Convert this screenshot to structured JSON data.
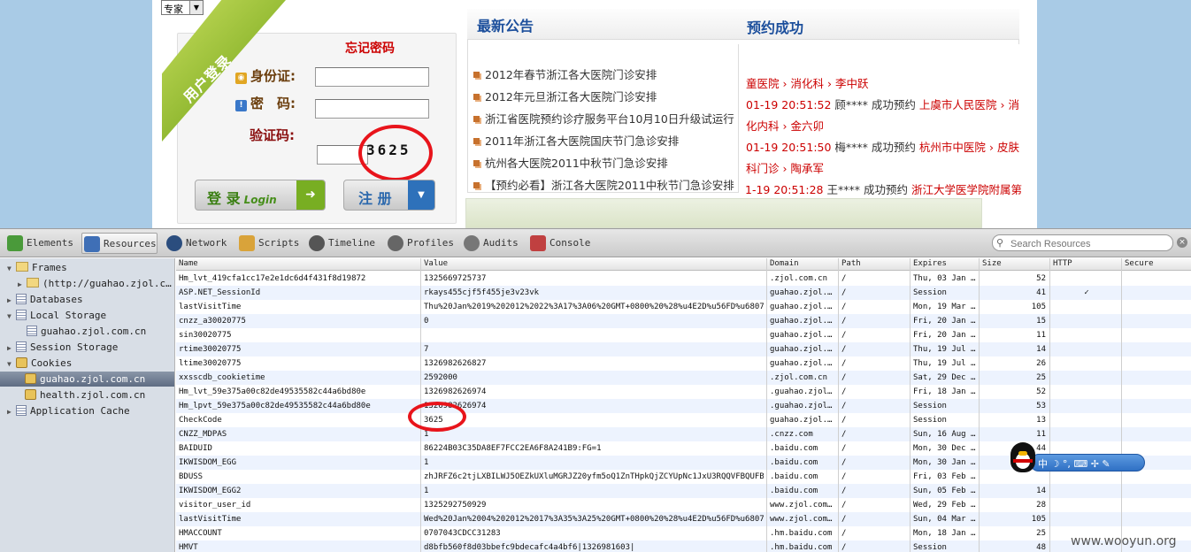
{
  "site": {
    "select_value": "专家",
    "login_ribbon": "用户登录",
    "forgot_password": "忘记密码",
    "id_label": "身份证:",
    "password_label": "密　码:",
    "captcha_label": "验证码:",
    "captcha_value": "3625",
    "login_button": "登 录",
    "login_button_sub": "Login",
    "register_button": "注 册",
    "news_title": "最新公告",
    "appt_title": "预约成功",
    "news_items": [
      "2012年春节浙江各大医院门诊安排",
      "2012年元旦浙江各大医院门诊安排",
      "浙江省医院预约诊疗服务平台10月10日升级试运行",
      "2011年浙江各大医院国庆节门急诊安排",
      "杭州各大医院2011中秋节门急诊安排",
      "【预约必看】浙江各大医院2011中秋节门急诊安排"
    ],
    "appointments": {
      "line1_a": "童医院",
      "line1_b": "消化科",
      "line1_c": "李中跃",
      "line2_time": "01-19 20:51:52",
      "line2_name": "顾****",
      "line2_action": "成功预约",
      "line2_hospital": "上虞市人民医院",
      "line2_dept_a": "消",
      "line3_dept_b": "化内科",
      "line3_doctor": "金六卯",
      "line4_time": "01-19 20:51:50",
      "line4_name": "梅****",
      "line4_action": "成功预约",
      "line4_hospital": "杭州市中医院",
      "line4_dept_a": "皮肤",
      "line5_dept_b": "科门诊",
      "line5_doctor": "陶承军",
      "line6_time": "1-19 20:51:28",
      "line6_name": "王****",
      "line6_action": "成功预约",
      "line6_hospital": "浙江大学医学院附属第"
    }
  },
  "devtools": {
    "tabs": [
      {
        "label": "Elements",
        "icon": "elements-icon",
        "color": "#4a9a3a"
      },
      {
        "label": "Resources",
        "icon": "resources-icon",
        "color": "#3f6fb6"
      },
      {
        "label": "Network",
        "icon": "network-icon",
        "color": "#2b4d7e"
      },
      {
        "label": "Scripts",
        "icon": "scripts-icon",
        "color": "#d9a33a"
      },
      {
        "label": "Timeline",
        "icon": "timeline-icon",
        "color": "#555555"
      },
      {
        "label": "Profiles",
        "icon": "profiles-icon",
        "color": "#666666"
      },
      {
        "label": "Audits",
        "icon": "audits-icon",
        "color": "#777777"
      },
      {
        "label": "Console",
        "icon": "console-icon",
        "color": "#c04040"
      }
    ],
    "search_placeholder": "Search Resources",
    "tree": {
      "frames": "Frames",
      "frame_child": "(http://guahao.zjol.c…",
      "databases": "Databases",
      "local_storage": "Local Storage",
      "local_storage_child": "guahao.zjol.com.cn",
      "session_storage": "Session Storage",
      "cookies": "Cookies",
      "cookie_selected": "guahao.zjol.com.cn",
      "cookie_other": "health.zjol.com.cn",
      "app_cache": "Application Cache"
    },
    "columns": [
      "Name",
      "Value",
      "Domain",
      "Path",
      "Expires",
      "Size",
      "HTTP",
      "Secure"
    ],
    "rows": [
      [
        "Hm_lvt_419cfa1cc17e2e1dc6d4f431f8d19872",
        "1325669725737",
        ".zjol.com.cn",
        "/",
        "Thu, 03 Jan …",
        "52",
        "",
        ""
      ],
      [
        "ASP.NET_SessionId",
        "rkays455cjf5f455je3v23vk",
        "guahao.zjol.…",
        "/",
        "Session",
        "41",
        "✓",
        ""
      ],
      [
        "lastVisitTime",
        "Thu%20Jan%2019%202012%2022%3A17%3A06%20GMT+0800%20%28%u4E2D%u56FD%u6807%u5…",
        "guahao.zjol.…",
        "/",
        "Mon, 19 Mar …",
        "105",
        "",
        ""
      ],
      [
        "cnzz_a30020775",
        "0",
        "guahao.zjol.…",
        "/",
        "Fri, 20 Jan …",
        "15",
        "",
        ""
      ],
      [
        "sin30020775",
        "",
        "guahao.zjol.…",
        "/",
        "Fri, 20 Jan …",
        "11",
        "",
        ""
      ],
      [
        "rtime30020775",
        "7",
        "guahao.zjol.…",
        "/",
        "Thu, 19 Jul …",
        "14",
        "",
        ""
      ],
      [
        "ltime30020775",
        "1326982626827",
        "guahao.zjol.…",
        "/",
        "Thu, 19 Jul …",
        "26",
        "",
        ""
      ],
      [
        "xxsscdb_cookietime",
        "2592000",
        ".zjol.com.cn",
        "/",
        "Sat, 29 Dec …",
        "25",
        "",
        ""
      ],
      [
        "Hm_lvt_59e375a00c82de49535582c44a6bd80e",
        "1326982626974",
        ".guahao.zjol…",
        "/",
        "Fri, 18 Jan …",
        "52",
        "",
        ""
      ],
      [
        "Hm_lpvt_59e375a00c82de49535582c44a6bd80e",
        "1326982626974",
        ".guahao.zjol…",
        "/",
        "Session",
        "53",
        "",
        ""
      ],
      [
        "CheckCode",
        "3625",
        "guahao.zjol.…",
        "/",
        "Session",
        "13",
        "",
        ""
      ],
      [
        "CNZZ_MDPAS",
        "1",
        ".cnzz.com",
        "/",
        "Sun, 16 Aug …",
        "11",
        "",
        ""
      ],
      [
        "BAIDUID",
        "86224B03C35DA8EF7FCC2EA6F8A241B9:FG=1",
        ".baidu.com",
        "/",
        "Mon, 30 Dec …",
        "44",
        "",
        ""
      ],
      [
        "IKWISDOM_EGG",
        "1",
        ".baidu.com",
        "/",
        "Mon, 30 Jan …",
        "",
        "",
        ""
      ],
      [
        "BDUSS",
        "zhJRFZ6c2tjLXBILWJ5OEZkUXluMGRJZ20yfm5oQ1ZnTHpkQjZCYUpNc1JxU3RQQVFBQUFBJCQ…",
        ".baidu.com",
        "/",
        "Fri, 03 Feb …",
        "",
        "",
        ""
      ],
      [
        "IKWISDOM_EGG2",
        "1",
        ".baidu.com",
        "/",
        "Sun, 05 Feb …",
        "14",
        "",
        ""
      ],
      [
        "visitor_user_id",
        "1325292750929",
        "www.zjol.com…",
        "/",
        "Wed, 29 Feb …",
        "28",
        "",
        ""
      ],
      [
        "lastVisitTime",
        "Wed%20Jan%2004%202012%2017%3A35%3A25%20GMT+0800%20%28%u4E2D%u56FD%u6807%u5…",
        "www.zjol.com…",
        "/",
        "Sun, 04 Mar …",
        "105",
        "",
        ""
      ],
      [
        "HMACCOUNT",
        "0707043CDCC31283",
        ".hm.baidu.com",
        "/",
        "Mon, 18 Jan …",
        "25",
        "",
        ""
      ],
      [
        "HMVT",
        "d8bfb560f8d03bbefc9bdecafc4a4bf6|1326981603|",
        ".hm.baidu.com",
        "/",
        "Session",
        "48",
        "",
        ""
      ]
    ]
  },
  "ime": {
    "label": "中 ☽ °, ⌨ ✢ ✎"
  },
  "watermark": "www.wooyun.org"
}
